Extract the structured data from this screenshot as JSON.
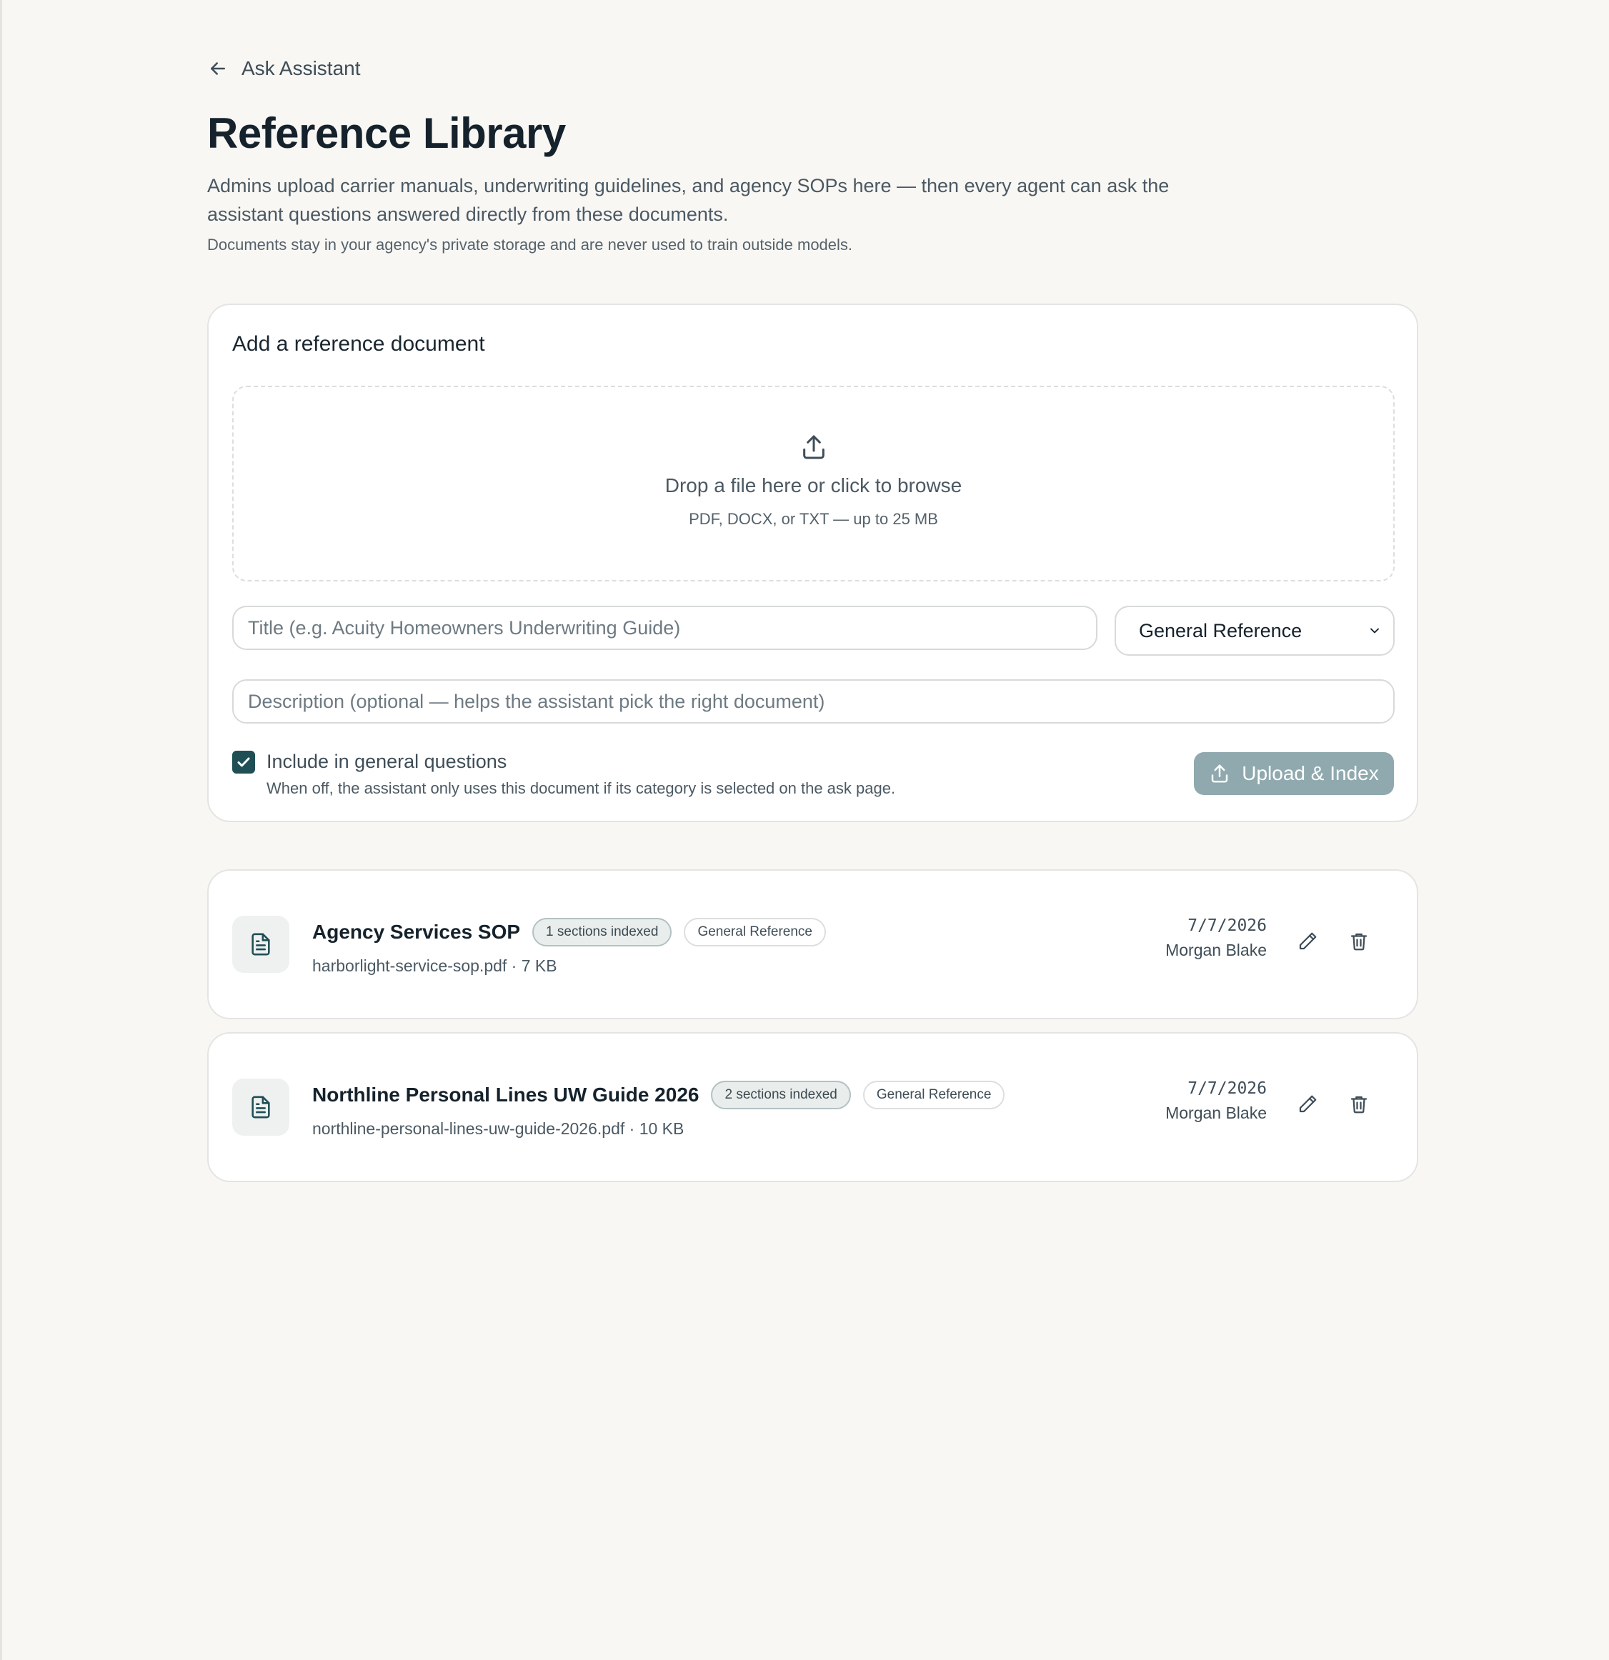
{
  "nav": {
    "back_label": "Ask Assistant"
  },
  "header": {
    "title": "Reference Library",
    "intro": "Admins upload carrier manuals, underwriting guidelines, and agency SOPs here — then every agent can ask the assistant questions answered directly from these documents.",
    "privacy_note": "Documents stay in your agency's private storage and are never used to train outside models."
  },
  "upload": {
    "heading": "Add a reference document",
    "dropzone_title": "Drop a file here or click to browse",
    "dropzone_hint": "PDF, DOCX, or TXT — up to 25 MB",
    "title_placeholder": "Title (e.g. Acuity Homeowners Underwriting Guide)",
    "category_selected": "General Reference",
    "description_placeholder": "Description (optional — helps the assistant pick the right document)",
    "include_checked": true,
    "include_label": "Include in general questions",
    "include_help": "When off, the assistant only uses this document if its category is selected on the ask page.",
    "button_label": "Upload & Index"
  },
  "documents": [
    {
      "title": "Agency Services SOP",
      "indexed_badge": "1 sections indexed",
      "category_badge": "General Reference",
      "meta": "harborlight-service-sop.pdf · 7 KB",
      "date": "7/7/2026",
      "author": "Morgan Blake"
    },
    {
      "title": "Northline Personal Lines UW Guide 2026",
      "indexed_badge": "2 sections indexed",
      "category_badge": "General Reference",
      "meta": "northline-personal-lines-uw-guide-2026.pdf · 10 KB",
      "date": "7/7/2026",
      "author": "Morgan Blake"
    }
  ],
  "icons": {
    "back": "arrow-left-icon",
    "upload": "upload-icon",
    "select": "chevron-down-icon",
    "checkbox": "checkmark-icon",
    "document": "file-text-icon",
    "edit": "pencil-icon",
    "delete": "trash-icon"
  },
  "colors": {
    "background": "#f8f7f4",
    "accent": "#1f4e55",
    "button_disabled": "#8fa9ae",
    "text_primary": "#15222c",
    "text_secondary": "#4b5963"
  }
}
